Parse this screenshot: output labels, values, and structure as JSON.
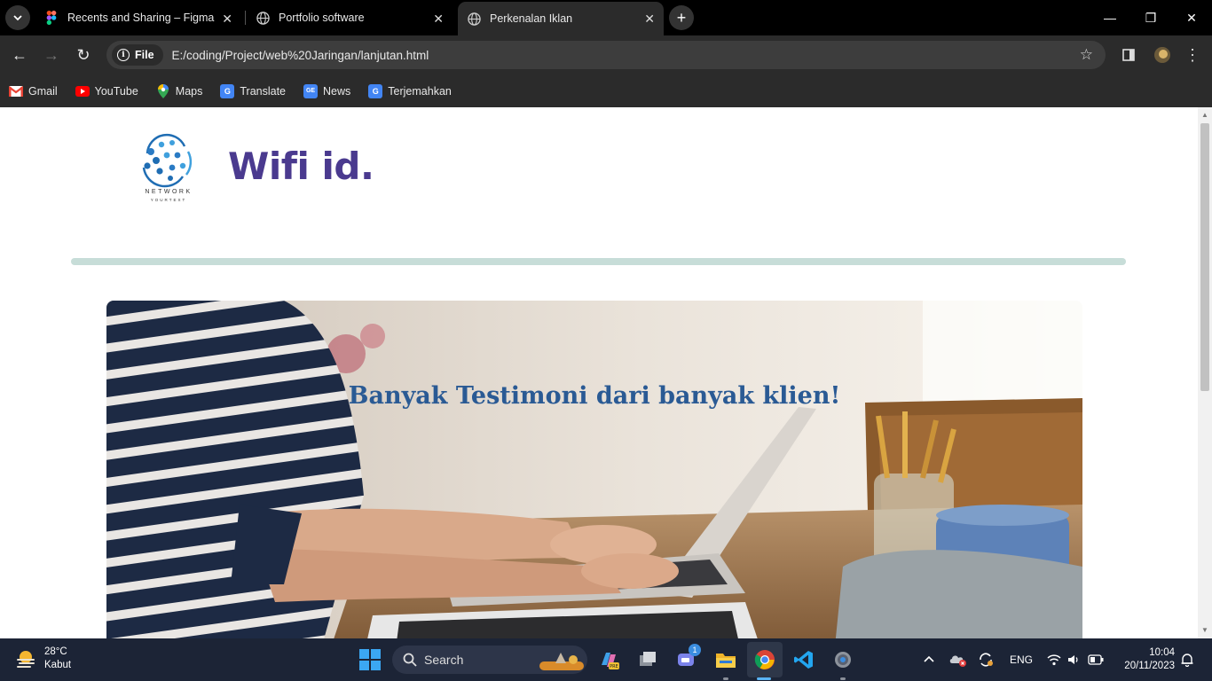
{
  "browser": {
    "tabs": [
      {
        "title": "Recents and Sharing – Figma",
        "icon": "figma-icon",
        "active": false
      },
      {
        "title": "Portfolio software",
        "icon": "globe-icon",
        "active": false
      },
      {
        "title": "Perkenalan Iklan",
        "icon": "globe-icon",
        "active": true
      }
    ],
    "new_tab": "+",
    "window_controls": {
      "minimize": "—",
      "restore": "❐",
      "close": "✕"
    }
  },
  "toolbar": {
    "back": "←",
    "forward": "→",
    "reload": "↻",
    "scheme_chip": "File",
    "url": "E:/coding/Project/web%20Jaringan/lanjutan.html",
    "bookmark_star": "☆"
  },
  "bookmarks": [
    {
      "label": "Gmail",
      "icon": "gmail-icon",
      "color": "#ea4335"
    },
    {
      "label": "YouTube",
      "icon": "youtube-icon",
      "color": "#ff0000"
    },
    {
      "label": "Maps",
      "icon": "maps-icon",
      "color": "#34a853"
    },
    {
      "label": "Translate",
      "icon": "translate-icon",
      "color": "#4285f4"
    },
    {
      "label": "News",
      "icon": "news-icon",
      "color": "#4285f4"
    },
    {
      "label": "Terjemahkan",
      "icon": "translate-icon",
      "color": "#4285f4"
    }
  ],
  "page": {
    "logo": {
      "word": "NETWORK",
      "tagline": "YOURTEXT"
    },
    "brand": "Wifi id.",
    "hero_title": "Banyak Testimoni dari banyak klien!",
    "colors": {
      "brand": "#4a3a8f",
      "divider": "#c7ddd8",
      "hero_title": "#2a5a94"
    }
  },
  "taskbar": {
    "weather": {
      "temp": "28°C",
      "condition": "Kabut"
    },
    "search_placeholder": "Search",
    "tray": {
      "language": "ENG"
    },
    "clock": {
      "time": "10:04",
      "date": "20/11/2023"
    },
    "chat_badge": "1"
  }
}
